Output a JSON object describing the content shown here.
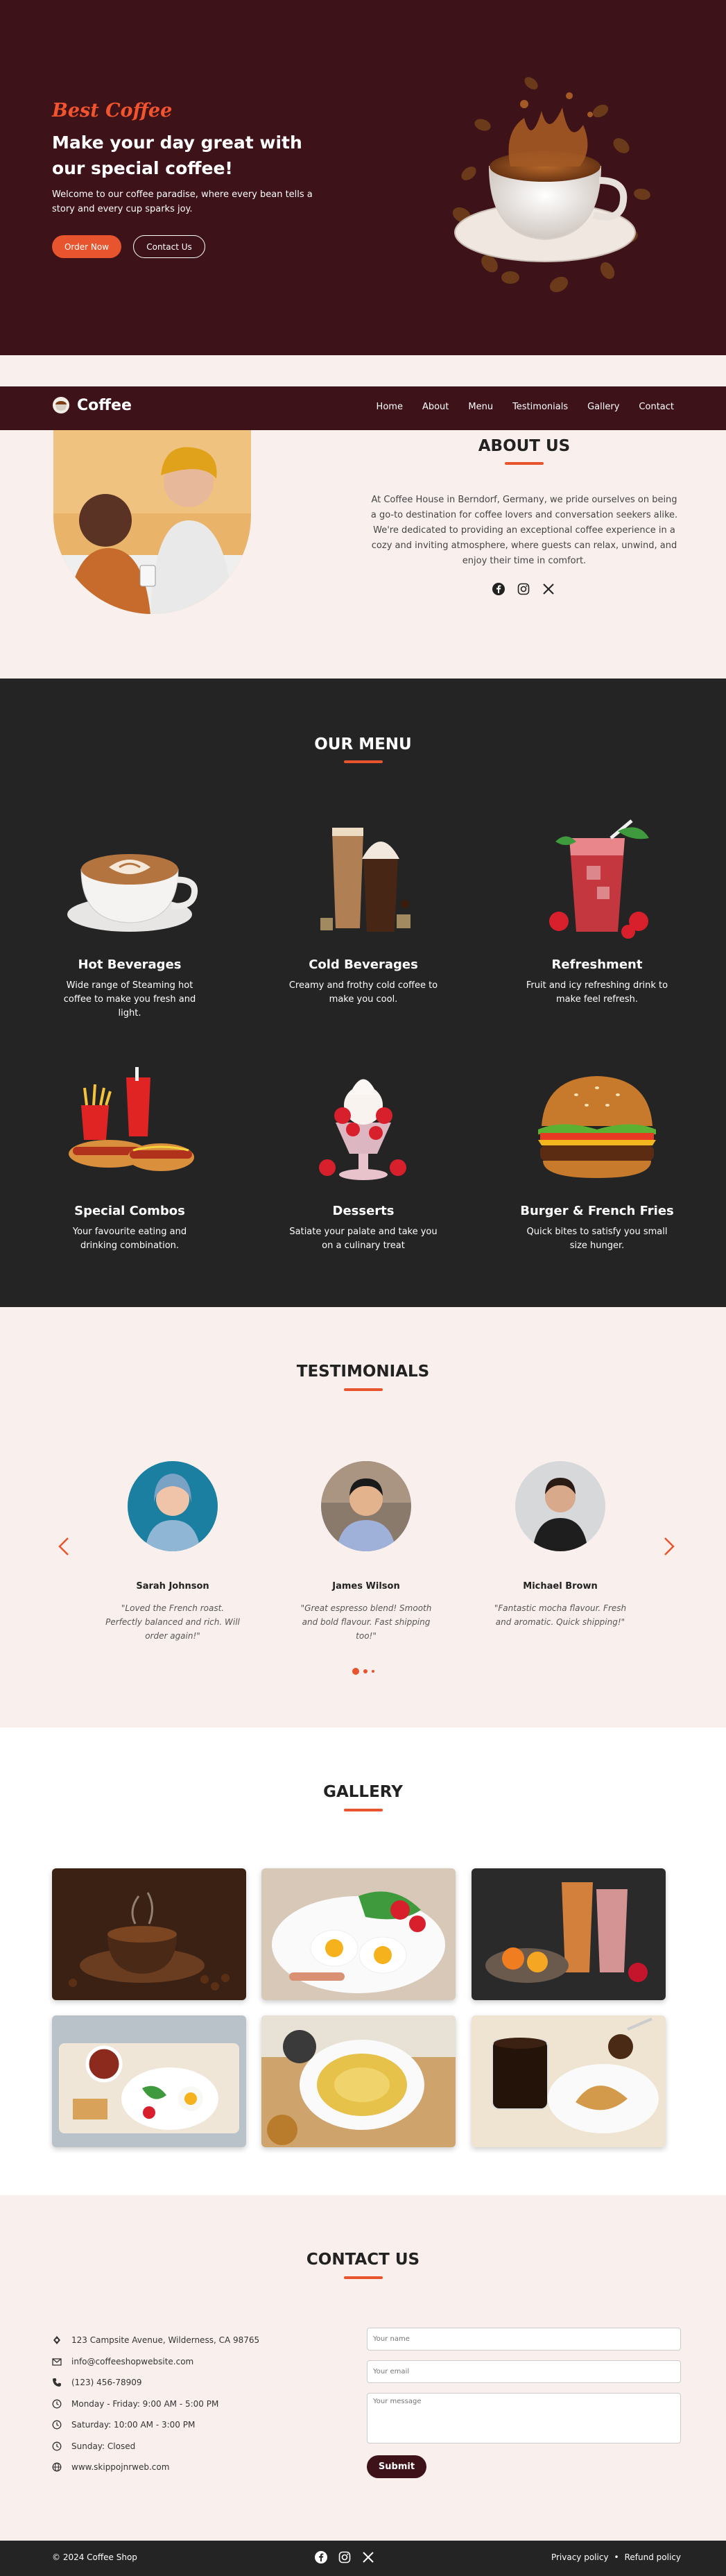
{
  "hero": {
    "brand": "Best Coffee",
    "headline": "Make your day great with our special coffee!",
    "subtext": "Welcome to our coffee paradise, where every bean tells a story and every cup sparks joy.",
    "order_button": "Order Now",
    "contact_button": "Contact Us"
  },
  "nav": {
    "logo_text": "Coffee",
    "items": [
      "Home",
      "About",
      "Menu",
      "Testimonials",
      "Gallery",
      "Contact"
    ]
  },
  "about": {
    "title": "ABOUT US",
    "body": "At Coffee House in Berndorf, Germany, we pride ourselves on being a go-to destination for coffee lovers and conversation seekers alike. We're dedicated to providing an exceptional coffee experience in a cozy and inviting atmosphere, where guests can relax, unwind, and enjoy their time in comfort."
  },
  "menu": {
    "title": "OUR MENU",
    "items": [
      {
        "title": "Hot Beverages",
        "desc": "Wide range of Steaming hot coffee to make you fresh and light."
      },
      {
        "title": "Cold Beverages",
        "desc": "Creamy and frothy cold coffee to make you cool."
      },
      {
        "title": "Refreshment",
        "desc": "Fruit and icy refreshing drink to make feel refresh."
      },
      {
        "title": "Special Combos",
        "desc": "Your favourite eating and drinking combination."
      },
      {
        "title": "Desserts",
        "desc": "Satiate your palate and take you on a culinary treat"
      },
      {
        "title": "Burger & French Fries",
        "desc": "Quick bites to satisfy you small size hunger."
      }
    ]
  },
  "testimonials": {
    "title": "TESTIMONIALS",
    "items": [
      {
        "name": "Sarah Johnson",
        "quote": "\"Loved the French roast. Perfectly balanced and rich. Will order again!\""
      },
      {
        "name": "James Wilson",
        "quote": "\"Great espresso blend! Smooth and bold flavour. Fast shipping too!\""
      },
      {
        "name": "Michael Brown",
        "quote": "\"Fantastic mocha flavour. Fresh and aromatic. Quick shipping!\""
      }
    ]
  },
  "gallery": {
    "title": "GALLERY"
  },
  "contact": {
    "title": "CONTACT US",
    "details": [
      {
        "icon": "location-icon",
        "text": "123 Campsite Avenue, Wilderness, CA 98765"
      },
      {
        "icon": "mail-icon",
        "text": "info@coffeeshopwebsite.com"
      },
      {
        "icon": "phone-icon",
        "text": "(123) 456-78909"
      },
      {
        "icon": "clock-icon",
        "text": "Monday - Friday: 9:00 AM - 5:00 PM"
      },
      {
        "icon": "clock-icon",
        "text": "Saturday: 10:00 AM - 3:00 PM"
      },
      {
        "icon": "clock-icon",
        "text": "Sunday: Closed"
      },
      {
        "icon": "globe-icon",
        "text": "www.skippojnrweb.com"
      }
    ],
    "name_placeholder": "Your name",
    "email_placeholder": "Your email",
    "message_placeholder": "Your message",
    "submit": "Submit"
  },
  "footer": {
    "copyright": "© 2024 Coffee Shop",
    "privacy": "Privacy policy",
    "separator": "•",
    "refund": "Refund policy"
  },
  "colors": {
    "brand_dark": "#3d1219",
    "accent": "#e8542d",
    "dark_bg": "#242424",
    "light_bg": "#f9f0ee"
  }
}
